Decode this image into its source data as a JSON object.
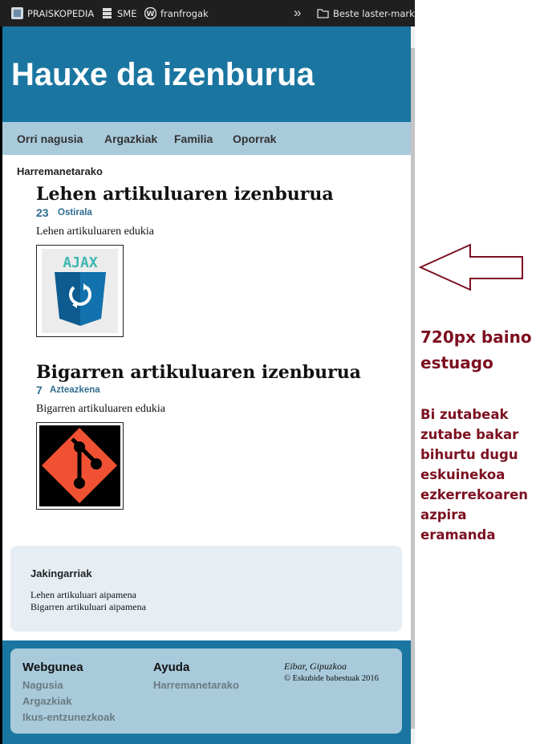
{
  "bookmarks": [
    {
      "label": "PRAISKOPEDIA",
      "icon": "wiki-icon"
    },
    {
      "label": "SME",
      "icon": "server-icon"
    },
    {
      "label": "franfrogak",
      "icon": "wordpress-icon"
    },
    {
      "label": "Beste laster-markak",
      "icon": "folder-icon"
    }
  ],
  "site": {
    "title": "Hauxe da izenburua",
    "nav": [
      "Orri nagusia",
      "Argazkiak",
      "Familia",
      "Oporrak"
    ],
    "contact": "Harremanetarako"
  },
  "articles": [
    {
      "title": "Lehen artikuluaren izenburua",
      "day_num": "23",
      "day_name": "Ostirala",
      "body": "Lehen artikuluaren edukia",
      "image": "ajax-logo",
      "image_text": "AJAX"
    },
    {
      "title": "Bigarren artikuluaren izenburua",
      "day_num": "7",
      "day_name": "Azteazkena",
      "body": "Bigarren artikuluaren edukia",
      "image": "git-logo"
    }
  ],
  "aside": {
    "title": "Jakingarriak",
    "items": [
      "Lehen artikuluari aipamena",
      "Bigarren artikuluari aipamena"
    ]
  },
  "footer": {
    "col1": {
      "title": "Webgunea",
      "links": [
        "Nagusia",
        "Argazkiak",
        "Ikus-entzunezkoak"
      ]
    },
    "col2": {
      "title": "Ayuda",
      "links": [
        "Harremanetarako"
      ]
    },
    "location": "Eibar, Gipuzkoa",
    "copyright": "© Eskubide babestuak 2016"
  },
  "annotation": {
    "heading": "720px baino estuago",
    "body": "Bi zutabeak zutabe bakar bihurtu dugu eskuinekoa ezkerrekoaren azpira eramanda",
    "color": "#7c1020"
  },
  "colors": {
    "header": "#1a76a0",
    "nav": "#a8cadb",
    "aside": "#e6eef4",
    "date": "#2f6d8f"
  }
}
